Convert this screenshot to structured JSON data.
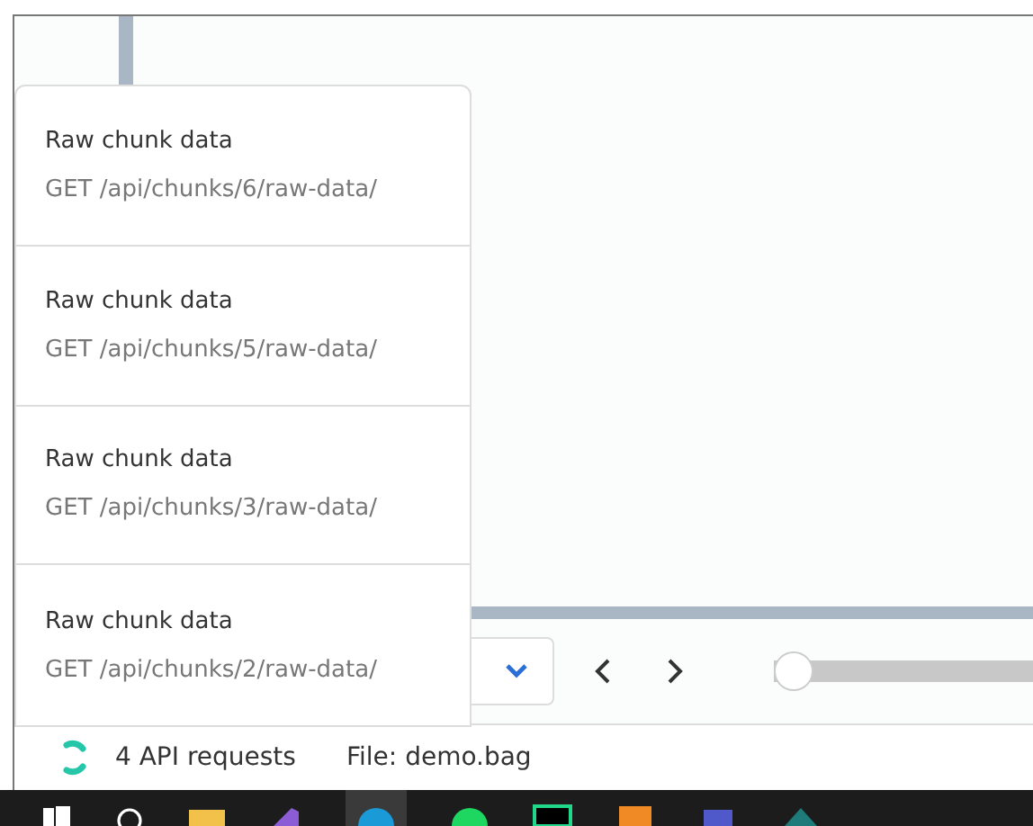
{
  "requests_popover": {
    "items": [
      {
        "title": "Raw chunk data",
        "request": "GET /api/chunks/6/raw-data/"
      },
      {
        "title": "Raw chunk data",
        "request": "GET /api/chunks/5/raw-data/"
      },
      {
        "title": "Raw chunk data",
        "request": "GET /api/chunks/3/raw-data/"
      },
      {
        "title": "Raw chunk data",
        "request": "GET /api/chunks/2/raw-data/"
      }
    ]
  },
  "player": {
    "slider": {
      "level": 0
    }
  },
  "status_bar": {
    "requests": "4 API requests",
    "file": "File: demo.bag"
  }
}
